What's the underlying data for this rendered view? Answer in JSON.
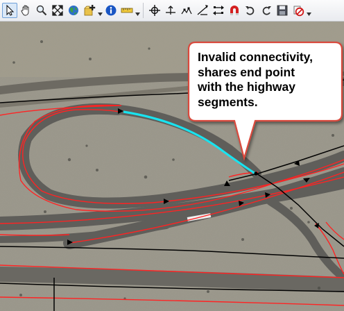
{
  "toolbar": {
    "tools": [
      {
        "name": "select-arrow-icon",
        "state": "active"
      },
      {
        "name": "pan-hand-icon"
      },
      {
        "name": "zoom-icon"
      },
      {
        "name": "full-extent-icon"
      },
      {
        "name": "globe-icon"
      },
      {
        "name": "add-data-icon"
      },
      {
        "name": "identify-info-icon"
      },
      {
        "name": "measure-ruler-icon"
      },
      {
        "name": "snap-crosshair-icon"
      },
      {
        "name": "split-tool-icon"
      },
      {
        "name": "vertex-edit-icon"
      },
      {
        "name": "reshape-icon"
      },
      {
        "name": "flip-icon"
      },
      {
        "name": "magnet-snapping-icon"
      },
      {
        "name": "undo-icon"
      },
      {
        "name": "redo-icon"
      },
      {
        "name": "save-icon"
      },
      {
        "name": "stop-editing-icon"
      }
    ]
  },
  "callout": {
    "text": "Invalid connectivity,\nshares end point\nwith the highway\nsegments."
  },
  "colors": {
    "road_outline": "#ff2222",
    "network_edge": "#000000",
    "highlighted_edge": "#19e3ef",
    "callout_border": "#d94a3c"
  }
}
